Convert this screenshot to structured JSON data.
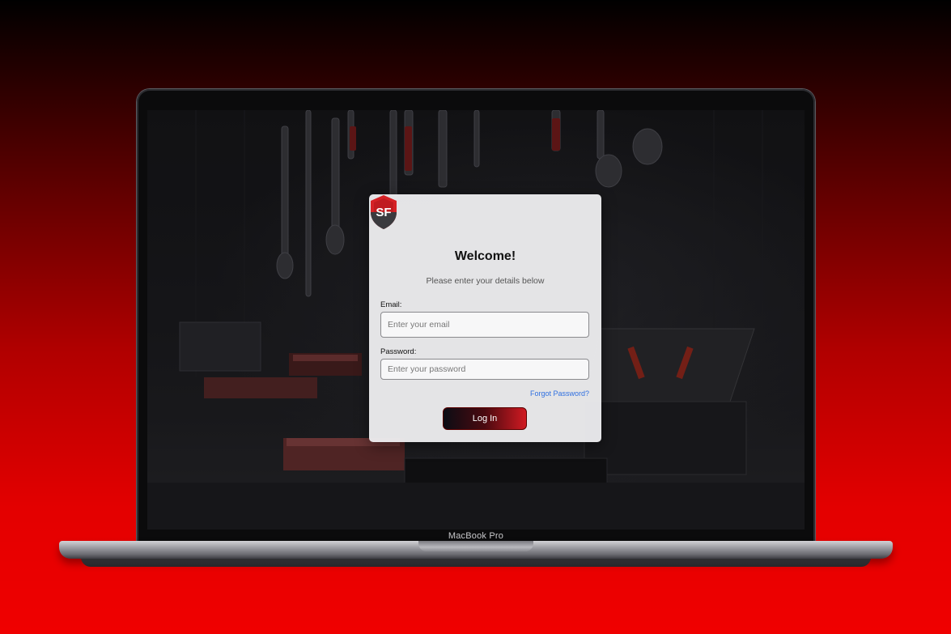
{
  "device": {
    "label": "MacBook Pro"
  },
  "login": {
    "title": "Welcome!",
    "subtitle": "Please enter your details below",
    "email_label": "Email:",
    "email_placeholder": "Enter your email",
    "email_value": "",
    "password_label": "Password:",
    "password_placeholder": "Enter your password",
    "password_value": "",
    "forgot_link": "Forgot Password?",
    "login_button": "Log In",
    "logo_icon": "shield-sf-logo-icon",
    "logo_text": "SF"
  },
  "colors": {
    "background_top": "#000000",
    "background_bottom": "#f00000",
    "accent_red": "#d01a22",
    "link_blue": "#2f6fe0",
    "card_bg": "#ececee"
  }
}
